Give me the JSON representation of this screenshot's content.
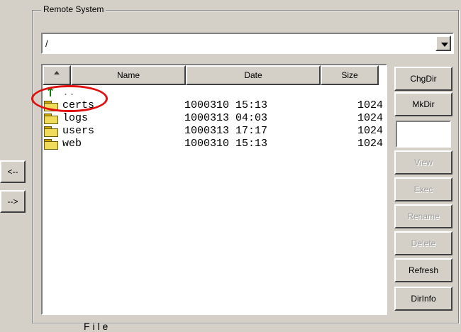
{
  "group": {
    "title": "Remote System"
  },
  "path": {
    "value": "/"
  },
  "columns": {
    "sort_indicator": "up",
    "name": "Name",
    "date": "Date",
    "size": "Size"
  },
  "parent_row": {
    "label": ".."
  },
  "rows": [
    {
      "name": "certs",
      "date": "1000310 15:13",
      "size": "1024"
    },
    {
      "name": "logs",
      "date": "1000313 04:03",
      "size": "1024"
    },
    {
      "name": "users",
      "date": "1000313 17:17",
      "size": "1024"
    },
    {
      "name": "web",
      "date": "1000310 15:13",
      "size": "1024"
    }
  ],
  "side_buttons": {
    "chgdir": "ChgDir",
    "mkdir": "MkDir",
    "view": "View",
    "exec": "Exec",
    "rename": "Rename",
    "delete": "Delete",
    "refresh": "Refresh",
    "dirinfo": "DirInfo"
  },
  "side_input": {
    "value": ""
  },
  "nav": {
    "left": "<--",
    "right": "-->"
  },
  "footer": {
    "partial_text": "F i l e"
  },
  "colors": {
    "highlight": "#e01010",
    "folder": "#f0dc5a",
    "up_arrow": "#0a7a0a"
  }
}
